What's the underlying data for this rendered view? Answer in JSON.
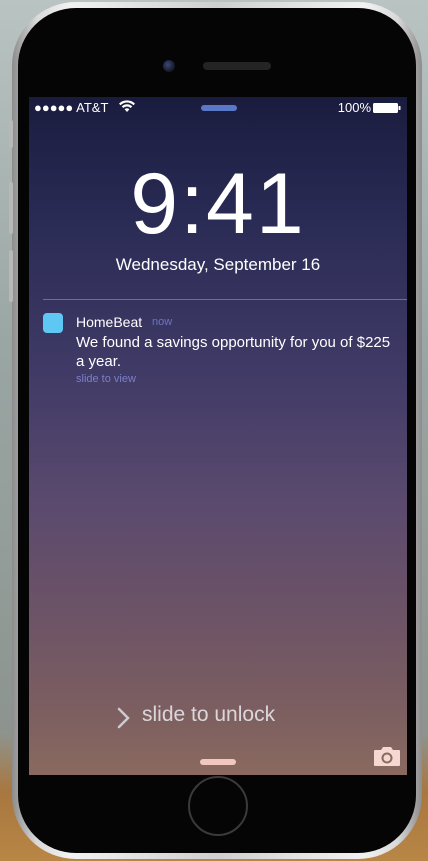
{
  "status_bar": {
    "carrier": "●●●●● AT&T",
    "battery": "100%"
  },
  "lock_screen": {
    "time": "9:41",
    "date": "Wednesday, September 16",
    "slide_to_unlock": "slide to unlock"
  },
  "notification": {
    "app_name": "HomeBeat",
    "time": "now",
    "message": "We found a savings opportunity for you of $225 a year.",
    "action_hint": "slide to view"
  },
  "colors": {
    "app_icon": "#5fc7f4",
    "home_indicator": "#f2c7bf"
  },
  "icons": [
    "wifi-icon",
    "battery-icon",
    "chevron-right-icon",
    "camera-icon"
  ]
}
